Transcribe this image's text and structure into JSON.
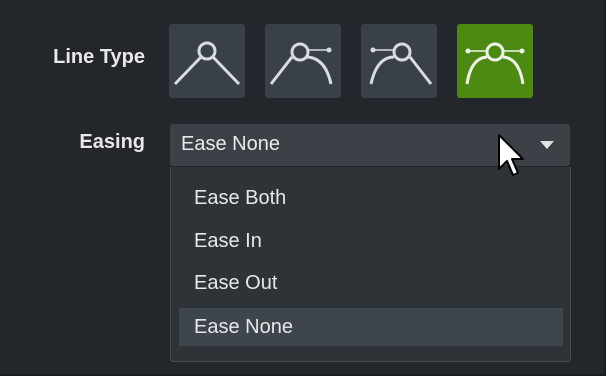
{
  "line_type": {
    "label": "Line Type",
    "options": [
      {
        "icon": "line-type-straight-icon",
        "active": false
      },
      {
        "icon": "line-type-curve-left-icon",
        "active": false
      },
      {
        "icon": "line-type-curve-right-icon",
        "active": false
      },
      {
        "icon": "line-type-curve-both-icon",
        "active": true
      }
    ],
    "active_color": "#4d8a14"
  },
  "easing": {
    "label": "Easing",
    "value": "Ease None",
    "options": [
      "Ease Both",
      "Ease In",
      "Ease Out",
      "Ease None"
    ],
    "selected_index": 3
  },
  "colors": {
    "panel_bg": "#23272c",
    "button_bg": "#3a4047",
    "text": "#e6e8ea"
  },
  "cursor": {
    "icon": "mouse-pointer-icon"
  }
}
